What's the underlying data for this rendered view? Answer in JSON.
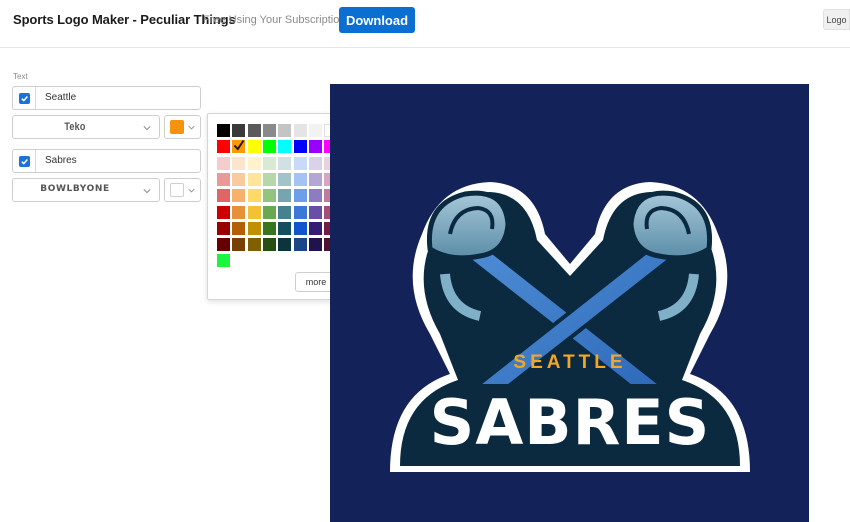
{
  "header": {
    "title": "Sports Logo Maker - Peculiar Things",
    "subtitle": "Free Using Your Subscription!",
    "download_label": "Download",
    "logo_tab_label": "Logo"
  },
  "panel": {
    "section_label": "Text",
    "rows": [
      {
        "checked": true,
        "text": "Seattle",
        "font": "Teko",
        "color": "#f5920e"
      },
      {
        "checked": true,
        "text": "Sabres",
        "font": "BOWLBYONE",
        "color": "#ffffff"
      }
    ]
  },
  "picker": {
    "selected_color": "#f5920e",
    "more_label": "more",
    "rows": [
      [
        "#000000",
        "#3a3a3a",
        "#5a5a5a",
        "#8a8a8a",
        "#c4c4c4",
        "#e4e4e4",
        "#f2f2f2",
        "#ffffff"
      ],
      [
        "#ff0000",
        "#ff9900",
        "#ffff00",
        "#00ff00",
        "#00ffff",
        "#0000ff",
        "#9900ff",
        "#ff00ff"
      ],
      [
        "#f4cccc",
        "#fce5cd",
        "#fff2cc",
        "#d9ead3",
        "#d0e0e3",
        "#c9daf8",
        "#d9d2e9",
        "#ead1dc"
      ],
      [
        "#ea9999",
        "#f9cb9c",
        "#ffe599",
        "#b6d7a8",
        "#a2c4c9",
        "#a4c2f4",
        "#b4a7d6",
        "#d5a6bd"
      ],
      [
        "#e06666",
        "#f6b26b",
        "#ffd966",
        "#93c47d",
        "#76a5af",
        "#6d9eeb",
        "#8e7cc3",
        "#c27ba0"
      ],
      [
        "#cc0000",
        "#e69138",
        "#f1c232",
        "#6aa84f",
        "#45818e",
        "#3c78d8",
        "#674ea7",
        "#a64d79"
      ],
      [
        "#990000",
        "#b45f06",
        "#bf9000",
        "#38761d",
        "#134f5c",
        "#1155cc",
        "#351c75",
        "#741b47"
      ],
      [
        "#660000",
        "#783f04",
        "#7f6000",
        "#274e13",
        "#0c343d",
        "#1c4587",
        "#20124d",
        "#4c1130"
      ],
      [
        "#1bf542"
      ]
    ]
  },
  "canvas": {
    "background": "#13235a",
    "logo": {
      "top_text": "SEATTLE",
      "main_text": "SABRES",
      "accent_color": "#f5a623"
    }
  }
}
